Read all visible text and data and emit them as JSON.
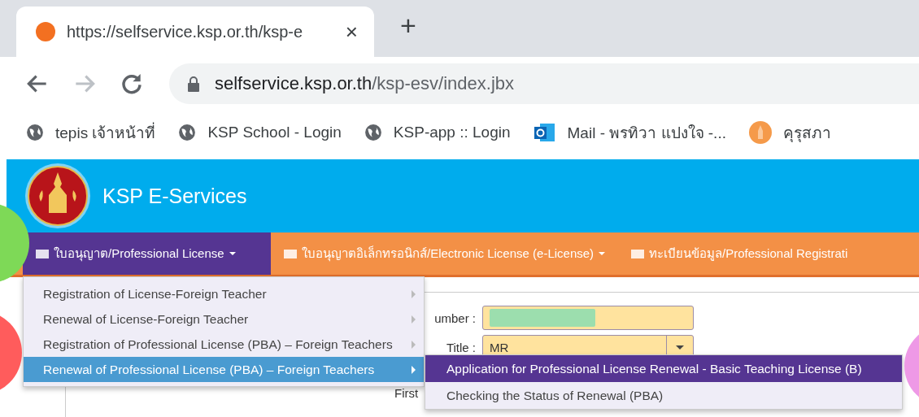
{
  "browser": {
    "tab": {
      "title": "https://selfservice.ksp.or.th/ksp-e",
      "close": "×"
    },
    "new_tab": "+",
    "address": {
      "host": "selfservice.ksp.or.th",
      "path": "/ksp-esv/index.jbx"
    },
    "bookmarks": [
      {
        "label": "tepis เจ้าหน้าที่",
        "kind": "globe"
      },
      {
        "label": "KSP School - Login",
        "kind": "globe"
      },
      {
        "label": "KSP-app :: Login",
        "kind": "globe"
      },
      {
        "label": "Mail - พรทิวา แปงใจ -...",
        "kind": "mail"
      },
      {
        "label": "คุรุสภา",
        "kind": "seal"
      }
    ]
  },
  "site": {
    "title": "KSP E-Services"
  },
  "nav": [
    {
      "label": "ใบอนุญาต/Professional License",
      "has_caret": true,
      "selected": true
    },
    {
      "label": "ใบอนุญาตอิเล็กทรอนิกส์/Electronic License (e-License)",
      "has_caret": true,
      "selected": false
    },
    {
      "label": "ทะเบียนข้อมูล/Professional Registrati",
      "has_caret": false,
      "selected": false
    }
  ],
  "menu": [
    {
      "label": "Registration of License-Foreign Teacher",
      "selected": false
    },
    {
      "label": "Renewal of License-Foreign Teacher",
      "selected": false
    },
    {
      "label": "Registration of Professional License (PBA) – Foreign Teachers",
      "selected": false
    },
    {
      "label": "Renewal of Professional License (PBA) – Foreign Teachers",
      "selected": true
    }
  ],
  "submenu": [
    {
      "label": "Application for Professional License Renewal - Basic Teaching License (B)",
      "selected": true
    },
    {
      "label": "Checking the Status of Renewal (PBA)",
      "selected": false
    }
  ],
  "form": [
    {
      "label": "umber :",
      "kind": "text"
    },
    {
      "label": "Title :",
      "kind": "select",
      "value": "MR"
    },
    {
      "label": "First",
      "kind": "label"
    }
  ]
}
